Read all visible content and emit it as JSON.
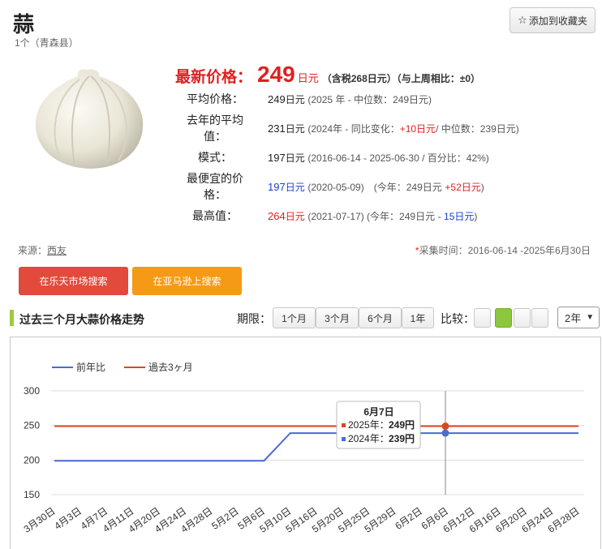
{
  "header": {
    "title": "蒜",
    "subtitle": "1个（青森县）",
    "favorite_label": "添加到收藏夹"
  },
  "price": {
    "latest_label": "最新价格：",
    "latest_value": "249",
    "latest_unit": "日元",
    "latest_note": "（含税268日元）（与上周相比：±0）",
    "rows": [
      {
        "label": "平均价格：",
        "value": "249",
        "unit": "日元",
        "detail": "(2025 年 - 中位数：249日元)"
      },
      {
        "label": "去年的平均值：",
        "value": "231",
        "unit": "日元",
        "detail_a": "(2024年 - 同比变化：",
        "detail_b": "+10日元",
        "detail_c": "/ 中位数：239日元)"
      },
      {
        "label": "模式：",
        "value": "197",
        "unit": "日元",
        "detail": "(2016-06-14 - 2025-06-30 / 百分比：42%)"
      },
      {
        "label": "最便宜的价格：",
        "value": "197",
        "unit": "日元",
        "detail_a": "(2020-05-09)　(今年：249",
        "detail_unit": "日元",
        "detail_b": "+52日元",
        "detail_c": ")"
      },
      {
        "label": "最高值：",
        "value": "264",
        "unit": "日元",
        "detail_a": "(2021-07-17) (今年：249",
        "detail_unit": "日元",
        "detail_b": "- 15",
        "detail_unit2": "日元",
        "detail_c": ")"
      }
    ]
  },
  "meta": {
    "source_label": "来源：",
    "source_link": "西友",
    "collect_label": "采集时间：2016-06-14 -2025年6月30日"
  },
  "buttons": {
    "rakuten": "在乐天市场搜索",
    "amazon": "在亚马逊上搜索"
  },
  "section": {
    "title": "过去三个月大蒜价格走势",
    "period_label": "期限：",
    "periods": [
      "1个月",
      "3个月",
      "6个月",
      "1年"
    ],
    "compare_label": "比较：",
    "year_select": "2年"
  },
  "colors": {
    "accent_red": "#e02020",
    "series_prev": "#4a6cd4",
    "series_recent": "#d9481c",
    "rakuten": "#e24a3b",
    "amazon": "#f59a16",
    "compare_active": "#8dc63f"
  },
  "chart_data": {
    "type": "line",
    "categories": [
      "3月30日",
      "4月3日",
      "4月7日",
      "4月11日",
      "4月20日",
      "4月24日",
      "4月28日",
      "5月2日",
      "5月6日",
      "5月10日",
      "5月16日",
      "5月20日",
      "5月25日",
      "5月29日",
      "6月2日",
      "6月6日",
      "6月12日",
      "6月16日",
      "6月20日",
      "6月24日",
      "6月28日"
    ],
    "yticks": [
      150,
      200,
      250,
      300
    ],
    "ylim": [
      150,
      300
    ],
    "legend_placement": "top-left",
    "grid": true,
    "series": [
      {
        "name": "前年比",
        "color": "#4a6cd4",
        "values": [
          199,
          199,
          199,
          199,
          199,
          199,
          199,
          199,
          199,
          239,
          239,
          239,
          239,
          239,
          239,
          239,
          239,
          239,
          239,
          239,
          239
        ]
      },
      {
        "name": "過去3ヶ月",
        "color": "#d9481c",
        "values": [
          249,
          249,
          249,
          249,
          249,
          249,
          249,
          249,
          249,
          249,
          249,
          249,
          249,
          249,
          249,
          249,
          249,
          249,
          249,
          249,
          249
        ]
      }
    ],
    "tooltip": {
      "title": "6月7日",
      "line1_label": "2025年：",
      "line1_value": "249円",
      "line2_label": "2024年：",
      "line2_value": "239円"
    }
  }
}
